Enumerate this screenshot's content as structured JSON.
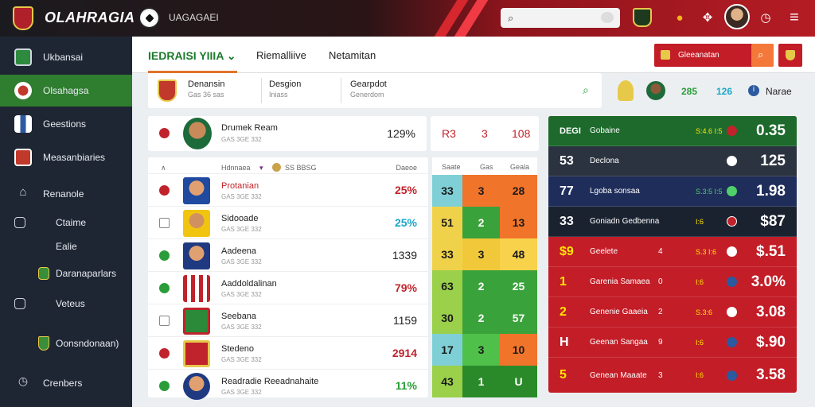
{
  "topbar": {
    "brand": "OLAHRAGIA",
    "subtitle": "UAGAGAEI"
  },
  "tabs": [
    {
      "label": "IEDRAISI YIIIA"
    },
    {
      "label": "Riemalliive"
    },
    {
      "label": "Netamitan"
    }
  ],
  "header_button": {
    "label": "Gleeanatan"
  },
  "sidebar": {
    "items": [
      {
        "label": "Ukbansai"
      },
      {
        "label": "Olsahagsa"
      },
      {
        "label": "Geestions"
      },
      {
        "label": "Measanbiaries"
      },
      {
        "label": "Renanole"
      },
      {
        "label": "Ctaime"
      },
      {
        "label": "Ealie"
      },
      {
        "label": "Daranaparlars"
      },
      {
        "label": "Veteus"
      },
      {
        "label": "Oonsndonaan)"
      },
      {
        "label": "Crenbers"
      }
    ]
  },
  "info": {
    "cols": [
      {
        "title": "Denansin",
        "sub": "Gas 36 sas"
      },
      {
        "title": "Desgion",
        "sub": "Iniass"
      },
      {
        "title": "Gearpdot",
        "sub": "Generdom"
      }
    ],
    "stats": [
      "285",
      "126"
    ],
    "status": "Narae"
  },
  "featured": {
    "name": "Drumek Ream",
    "sub": "GAS 3GE 332",
    "pct": "129%",
    "cells": [
      "R3",
      "3",
      "108"
    ]
  },
  "table": {
    "head": {
      "name": "Hdnnaea",
      "meta": "SS BBSG",
      "col": "Daeoe",
      "heat": [
        "Saate",
        "Gas",
        "Geala"
      ]
    },
    "rows": [
      {
        "name": "Protanian",
        "sub": "GAS 3GE 332",
        "pct": "25%",
        "pct_color": "#c0232b",
        "heat": [
          "33",
          "3",
          "28"
        ]
      },
      {
        "name": "Sidooade",
        "sub": "GAS 3GE 332",
        "pct": "25%",
        "pct_color": "#1aa6c8",
        "heat": [
          "51",
          "2",
          "13"
        ]
      },
      {
        "name": "Aadeena",
        "sub": "GAS 3GE 332",
        "pct": "1339",
        "pct_color": "#222222",
        "heat": [
          "33",
          "3",
          "48"
        ]
      },
      {
        "name": "Aaddoldalinan",
        "sub": "GAS 3GE 332",
        "pct": "79%",
        "pct_color": "#c0232b",
        "heat": [
          "63",
          "2",
          "25"
        ]
      },
      {
        "name": "Seebana",
        "sub": "GAS 3GE 332",
        "pct": "1159",
        "pct_color": "#222222",
        "heat": [
          "30",
          "2",
          "57"
        ]
      },
      {
        "name": "Stedeno",
        "sub": "GAS 3GE 332",
        "pct": "2914",
        "pct_color": "#c0232b",
        "heat": [
          "17",
          "3",
          "10"
        ]
      },
      {
        "name": "Readradie Reeadnahaite",
        "sub": "GAS 3GE 332",
        "pct": "11%",
        "pct_color": "#2a9d3a",
        "heat": [
          "43",
          "1",
          "U"
        ]
      }
    ]
  },
  "right_rows": [
    {
      "num": "DEGI",
      "label": "Gobaine",
      "mid": "",
      "small": "S:4.6 I:5",
      "value": "0.35"
    },
    {
      "num": "53",
      "label": "Declona",
      "mid": "",
      "small": "",
      "value": "125"
    },
    {
      "num": "77",
      "label": "Lgoba sonsaa",
      "mid": "",
      "small": "S.3:5 I:5",
      "value": "1.98"
    },
    {
      "num": "33",
      "label": "Goniadn Gedbenna",
      "mid": "",
      "small": "I:6",
      "value": "$87"
    },
    {
      "num": "$9",
      "label": "Geelete",
      "mid": "4",
      "small": "S.3 I:6",
      "value": "$.51"
    },
    {
      "num": "1",
      "label": "Garenia Samaea",
      "mid": "0",
      "small": "I:6",
      "value": "3.0%"
    },
    {
      "num": "2",
      "label": "Genenie Gaaeia",
      "mid": "2",
      "small": "S.3:6",
      "value": "3.08"
    },
    {
      "num": "H",
      "label": "Geenan Sangaa",
      "mid": "9",
      "small": "I:6",
      "value": "$.90"
    },
    {
      "num": "5",
      "label": "Genean Maaate",
      "mid": "3",
      "small": "I:6",
      "value": "3.58"
    }
  ],
  "colors": {
    "accent": "#2f7d2f",
    "brand_red": "#c31d27",
    "sidebar": "#1f2633"
  }
}
